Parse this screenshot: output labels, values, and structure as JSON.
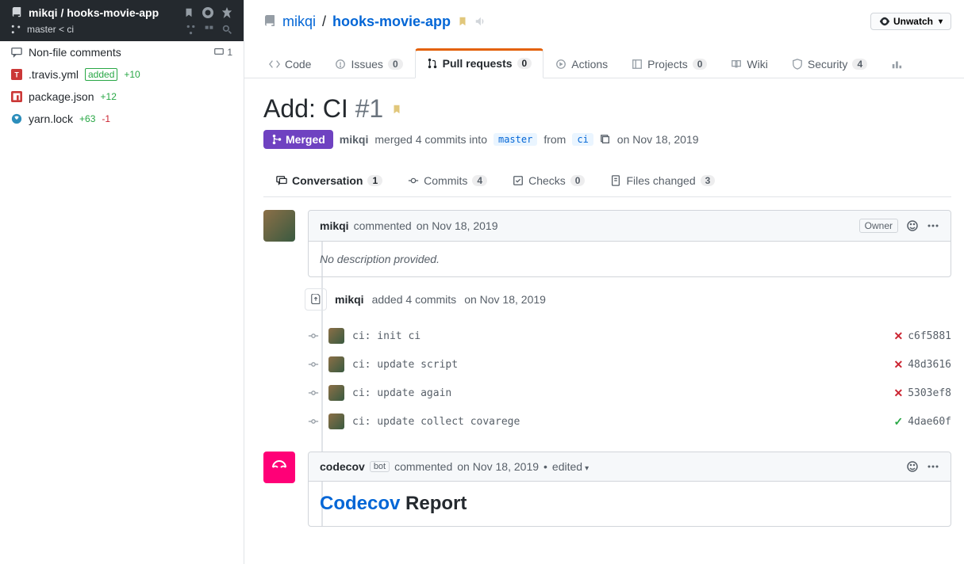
{
  "sidebar": {
    "owner": "mikqi",
    "repo": "hooks-movie-app",
    "baseBranch": "master",
    "compareBranch": "ci",
    "nonFileComments": "Non-file comments",
    "commentCount": "1",
    "files": [
      {
        "name": ".travis.yml",
        "badge": "added",
        "plus": "+10",
        "minus": ""
      },
      {
        "name": "package.json",
        "badge": "",
        "plus": "+12",
        "minus": ""
      },
      {
        "name": "yarn.lock",
        "badge": "",
        "plus": "+63",
        "minus": "-1"
      }
    ]
  },
  "header": {
    "owner": "mikqi",
    "repo": "hooks-movie-app",
    "unwatch": "Unwatch"
  },
  "navTabs": {
    "code": "Code",
    "issues": "Issues",
    "issuesCount": "0",
    "pullRequests": "Pull requests",
    "pullCount": "0",
    "actions": "Actions",
    "projects": "Projects",
    "projectsCount": "0",
    "wiki": "Wiki",
    "security": "Security",
    "securityCount": "4"
  },
  "pr": {
    "title": "Add: CI",
    "number": "#1",
    "status": "Merged",
    "author": "mikqi",
    "mergedText": "merged 4 commits into",
    "baseBranch": "master",
    "fromText": "from",
    "headBranch": "ci",
    "date": "on Nov 18, 2019"
  },
  "subTabs": {
    "conversation": "Conversation",
    "conversationCount": "1",
    "commits": "Commits",
    "commitsCount": "4",
    "checks": "Checks",
    "checksCount": "0",
    "filesChanged": "Files changed",
    "filesCount": "3"
  },
  "comment1": {
    "author": "mikqi",
    "action": "commented",
    "date": "on Nov 18, 2019",
    "badge": "Owner",
    "body": "No description provided."
  },
  "commitsEvent": {
    "author": "mikqi",
    "text": "added 4 commits",
    "date": "on Nov 18, 2019",
    "commits": [
      {
        "msg": "ci: init ci",
        "hash": "c6f5881",
        "status": "x"
      },
      {
        "msg": "ci: update script",
        "hash": "48d3616",
        "status": "x"
      },
      {
        "msg": "ci: update again",
        "hash": "5303ef8",
        "status": "x"
      },
      {
        "msg": "ci: update collect covarege",
        "hash": "4dae60f",
        "status": "check"
      }
    ]
  },
  "comment2": {
    "author": "codecov",
    "botLabel": "bot",
    "action": "commented",
    "date": "on Nov 18, 2019",
    "edited": "edited",
    "reportLink": "Codecov",
    "reportText": "Report"
  }
}
